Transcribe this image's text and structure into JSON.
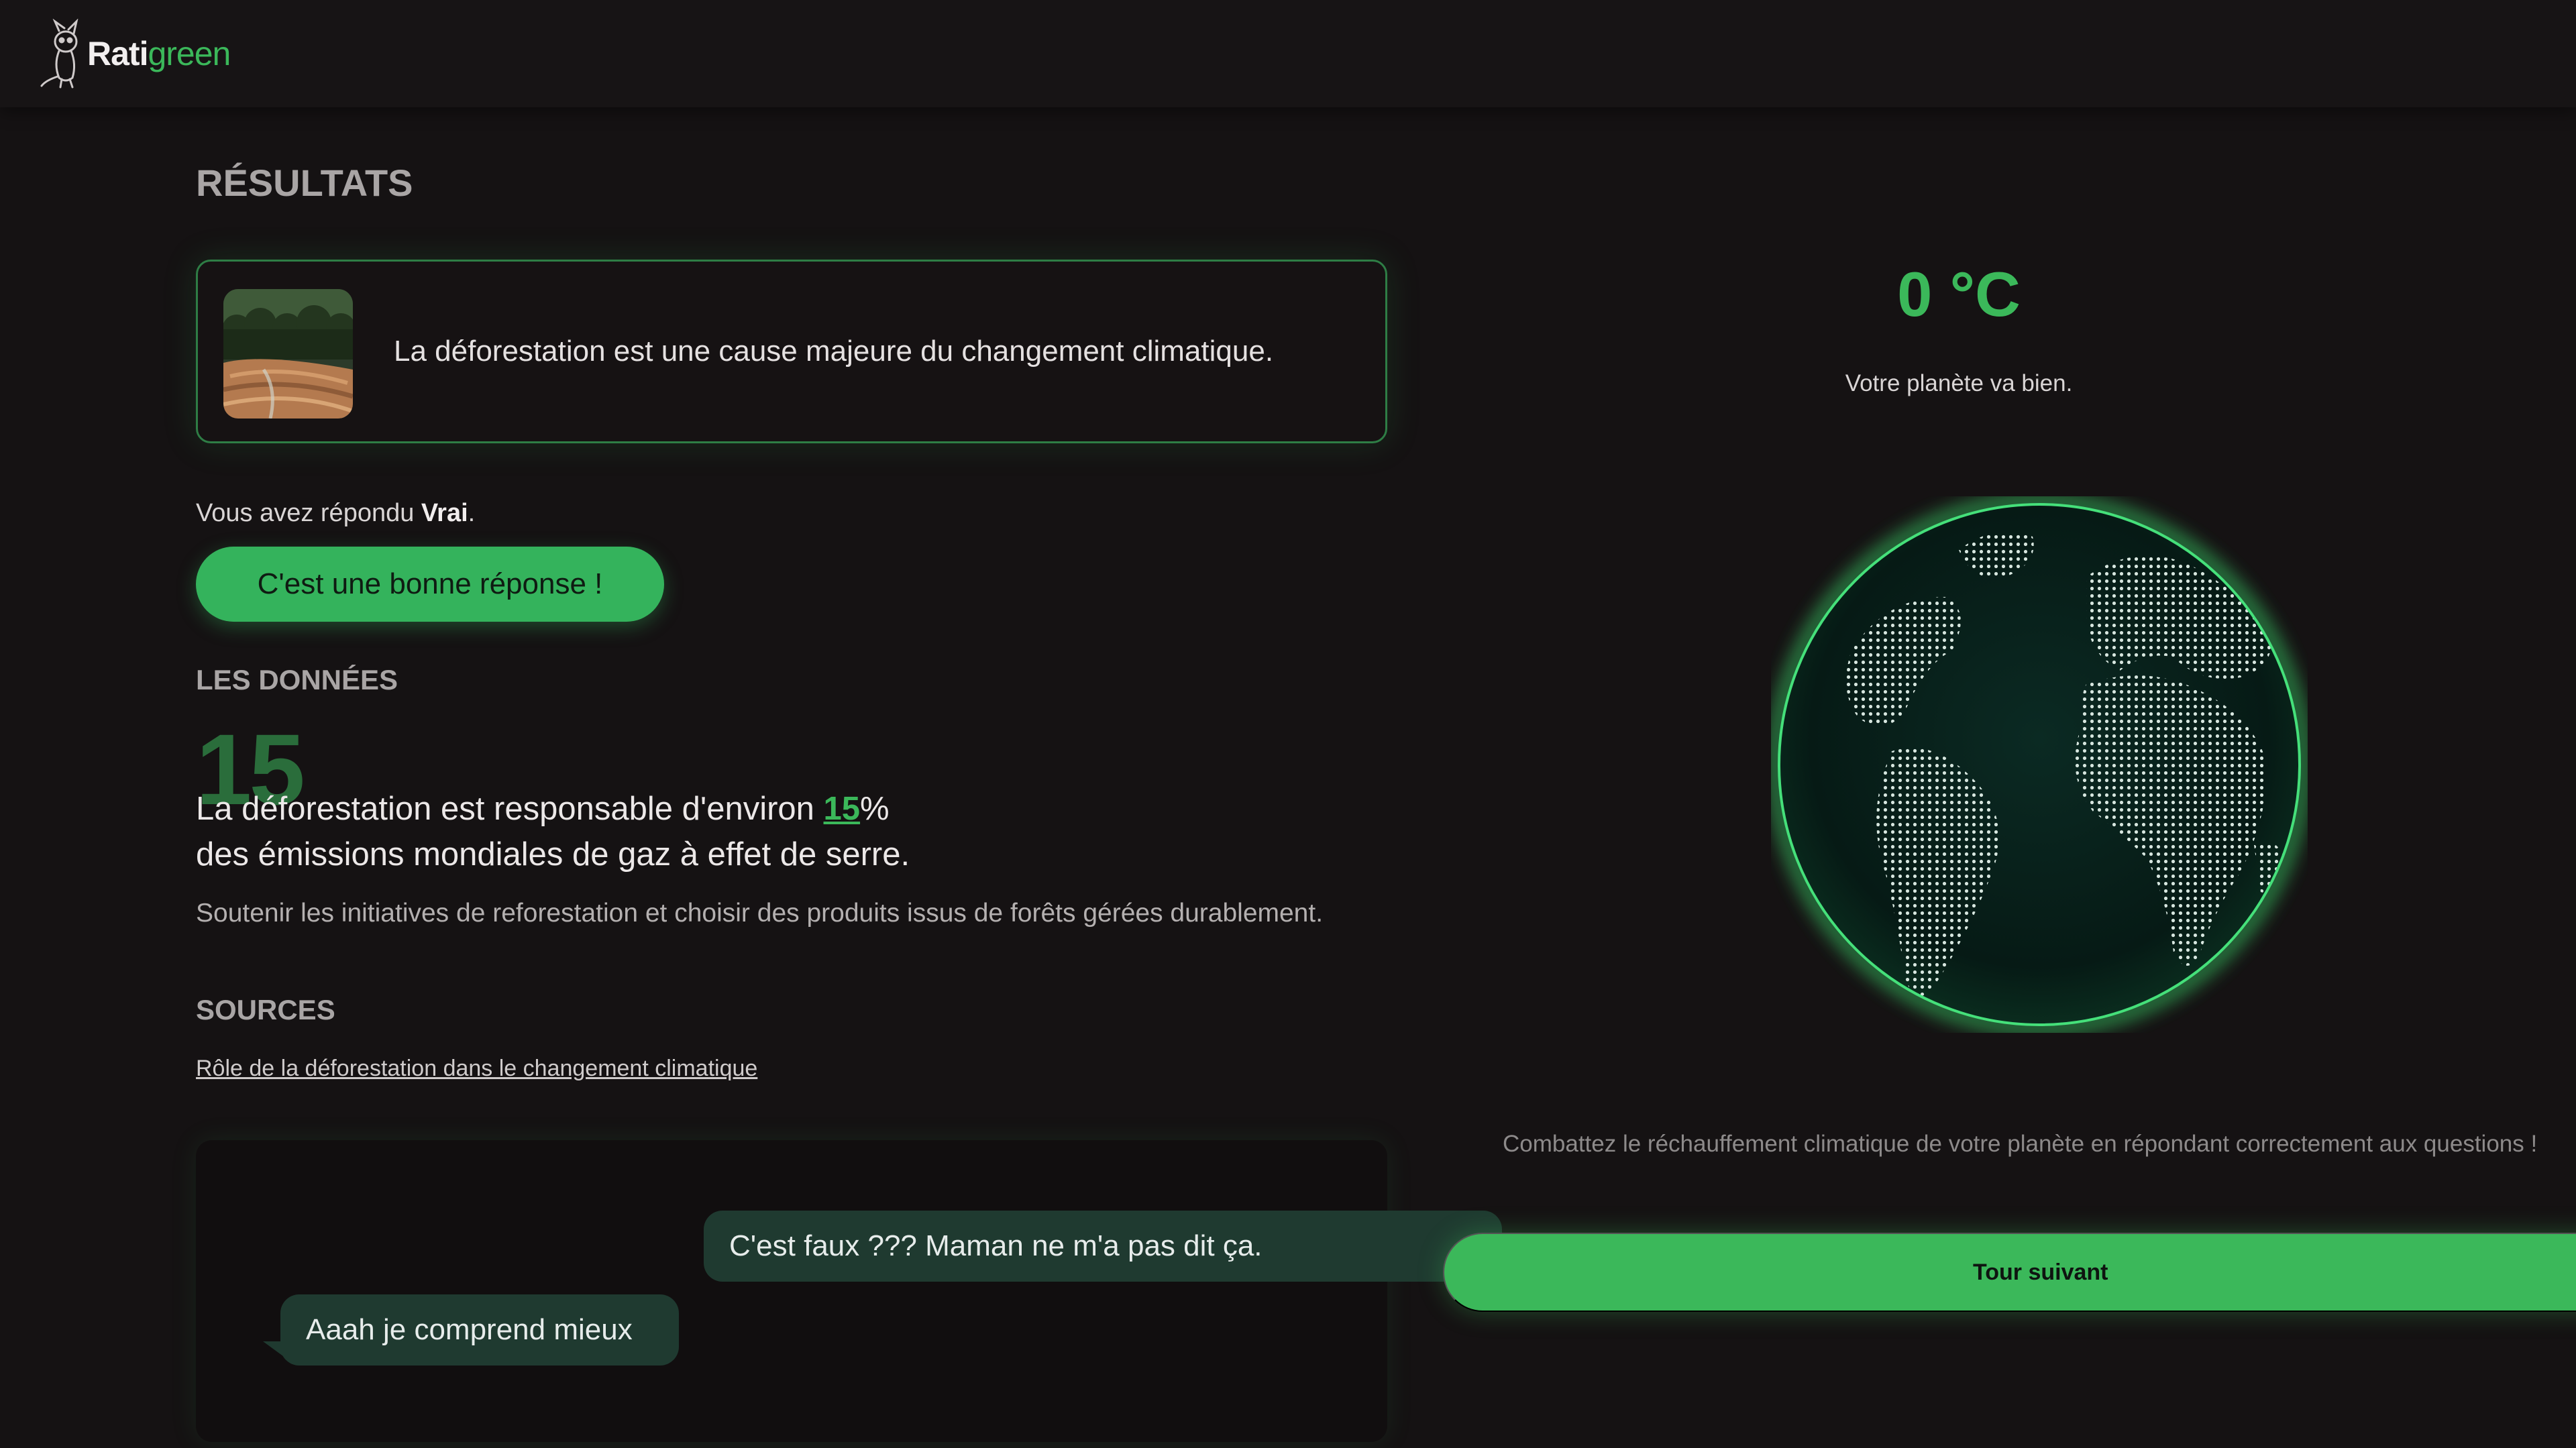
{
  "app": {
    "logo_part1": "Rati",
    "logo_part2": "green"
  },
  "page": {
    "title": "RÉSULTATS"
  },
  "question": {
    "statement": "La déforestation est une cause majeure du changement climatique."
  },
  "answer": {
    "prefix": "Vous avez répondu ",
    "value": "Vrai",
    "suffix": ".",
    "verdict": "C'est une bonne réponse !"
  },
  "data_section": {
    "label": "LES DONNÉES",
    "big_number": "15",
    "fact_before": "La déforestation est responsable d'environ ",
    "fact_highlight": "15",
    "fact_after": "%",
    "fact_line2": "des émissions mondiales de gaz à effet de serre.",
    "advice": "Soutenir les initiatives de reforestation et choisir des produits issus de forêts gérées durablement."
  },
  "sources": {
    "label": "SOURCES",
    "link": "Rôle de la déforestation dans le changement climatique"
  },
  "chat": {
    "messages": [
      {
        "side": "right",
        "text": "C'est faux ??? Maman ne m'a pas dit ça."
      },
      {
        "side": "left",
        "text": "Aaah je comprend mieux"
      }
    ]
  },
  "planet": {
    "temperature": "0 °C",
    "status": "Votre planète va bien.",
    "hint": "Combattez le réchauffement climatique de votre planète en répondant correctement aux questions !",
    "next_button": "Tour suivant"
  },
  "colors": {
    "accent": "#3bb85a",
    "background": "#151213",
    "bubble": "#1f3a30",
    "card_border": "#2e7d45"
  }
}
